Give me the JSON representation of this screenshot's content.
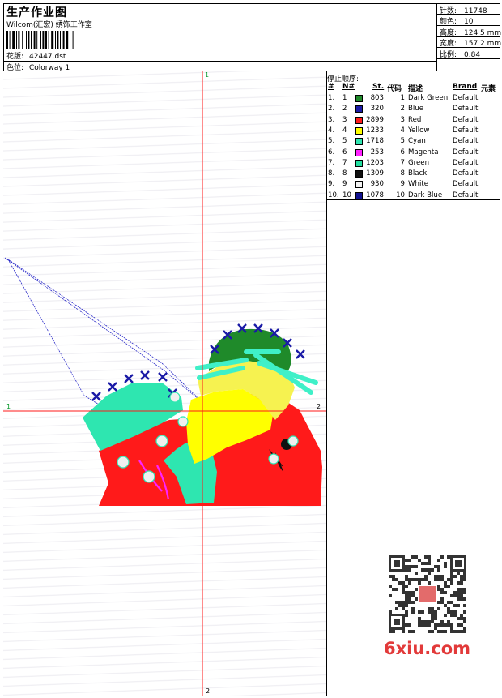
{
  "header": {
    "title": "生产作业图",
    "subtitle": "Wilcom(汇宏) 绣饰工作室",
    "design_label": "花版:",
    "design_value": "42447.dst",
    "colorway_label": "色位:",
    "colorway_value": "Colorway 1"
  },
  "stats": [
    {
      "label": "针数:",
      "value": "11748"
    },
    {
      "label": "颜色:",
      "value": "10"
    },
    {
      "label": "高度:",
      "value": "124.5 mm"
    },
    {
      "label": "宽度:",
      "value": "157.2 mm"
    },
    {
      "label": "比例:",
      "value": "0.84"
    }
  ],
  "legend": {
    "title": "停止顺序:",
    "headers": {
      "hash": "#",
      "no": "N#",
      "st": "St.",
      "code": "代码",
      "desc": "描述",
      "brand": "Brand",
      "elem": "元素"
    },
    "rows": [
      {
        "idx": "1.",
        "n": "1",
        "color": "#1f8a2a",
        "st": "803",
        "code": "1",
        "desc": "Dark Green",
        "brand": "Default"
      },
      {
        "idx": "2.",
        "n": "2",
        "color": "#1a1aa6",
        "st": "320",
        "code": "2",
        "desc": "Blue",
        "brand": "Default"
      },
      {
        "idx": "3.",
        "n": "3",
        "color": "#ff1a1a",
        "st": "2899",
        "code": "3",
        "desc": "Red",
        "brand": "Default"
      },
      {
        "idx": "4.",
        "n": "4",
        "color": "#ffff00",
        "st": "1233",
        "code": "4",
        "desc": "Yellow",
        "brand": "Default"
      },
      {
        "idx": "5.",
        "n": "5",
        "color": "#2ee6b0",
        "st": "1718",
        "code": "5",
        "desc": "Cyan",
        "brand": "Default"
      },
      {
        "idx": "6.",
        "n": "6",
        "color": "#ff22ff",
        "st": "253",
        "code": "6",
        "desc": "Magenta",
        "brand": "Default"
      },
      {
        "idx": "7.",
        "n": "7",
        "color": "#22dfa0",
        "st": "1203",
        "code": "7",
        "desc": "Green",
        "brand": "Default"
      },
      {
        "idx": "8.",
        "n": "8",
        "color": "#111111",
        "st": "1309",
        "code": "8",
        "desc": "Black",
        "brand": "Default"
      },
      {
        "idx": "9.",
        "n": "9",
        "color": "#f2f2f2",
        "st": "930",
        "code": "9",
        "desc": "White",
        "brand": "Default"
      },
      {
        "idx": "10.",
        "n": "10",
        "color": "#101090",
        "st": "1078",
        "code": "10",
        "desc": "Dark Blue",
        "brand": "Default"
      }
    ]
  },
  "axes": {
    "top": "1",
    "bottom": "2",
    "left": "1",
    "right": "2"
  },
  "watermark": {
    "text": "6xiu.com",
    "icon": "qr-code-icon"
  }
}
